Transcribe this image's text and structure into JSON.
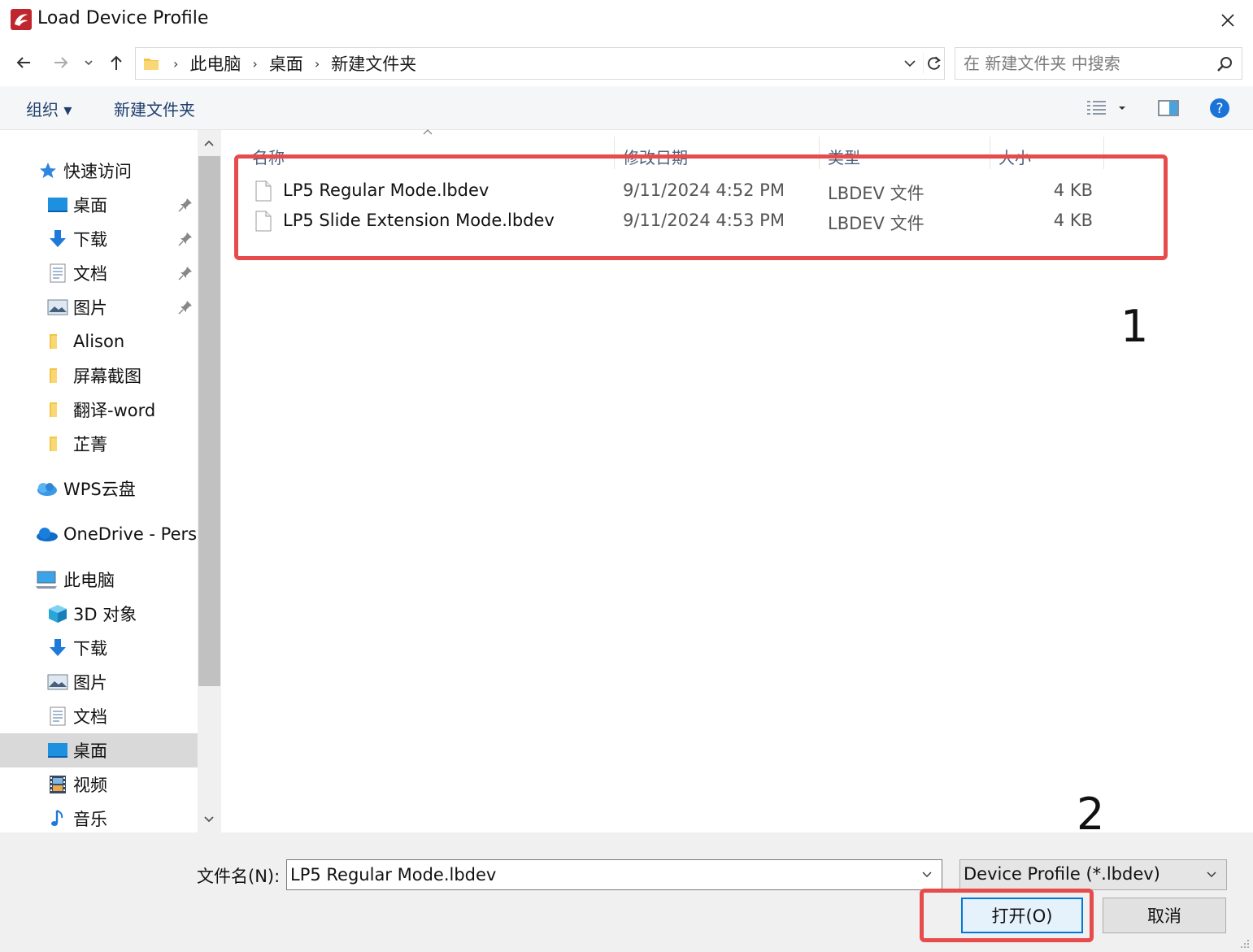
{
  "window": {
    "title": "Load Device Profile"
  },
  "address_bar": {
    "crumbs": [
      "此电脑",
      "桌面",
      "新建文件夹"
    ]
  },
  "search": {
    "placeholder": "在 新建文件夹 中搜索"
  },
  "toolbar": {
    "organize_label": "组织 ▾",
    "new_folder_label": "新建文件夹"
  },
  "nav": {
    "quick_access": "快速访问",
    "quick_items": [
      "桌面",
      "下载",
      "文档",
      "图片",
      "Alison",
      "屏幕截图",
      "翻译-word",
      "芷菁"
    ],
    "wps": "WPS云盘",
    "onedrive": "OneDrive - Persc",
    "this_pc": "此电脑",
    "pc_items": [
      "3D 对象",
      "下载",
      "图片",
      "文档",
      "桌面",
      "视频",
      "音乐"
    ],
    "selected": "桌面"
  },
  "columns": {
    "name": "名称",
    "date": "修改日期",
    "type": "类型",
    "size": "大小"
  },
  "files": [
    {
      "name": "LP5 Regular Mode.lbdev",
      "date": "9/11/2024 4:52 PM",
      "type": "LBDEV 文件",
      "size": "4 KB"
    },
    {
      "name": "LP5 Slide Extension Mode.lbdev",
      "date": "9/11/2024 4:53 PM",
      "type": "LBDEV 文件",
      "size": "4 KB"
    }
  ],
  "annotations": {
    "step1": "1",
    "step2": "2"
  },
  "bottom": {
    "filename_label": "文件名(N):",
    "filename_value": "LP5 Regular Mode.lbdev",
    "filetype_value": "Device Profile (*.lbdev)",
    "open_label": "打开(O)",
    "cancel_label": "取消"
  },
  "colors": {
    "annotation_red": "#e74c4c",
    "accent_blue": "#0078d7",
    "link_blue": "#1f3f6e"
  }
}
